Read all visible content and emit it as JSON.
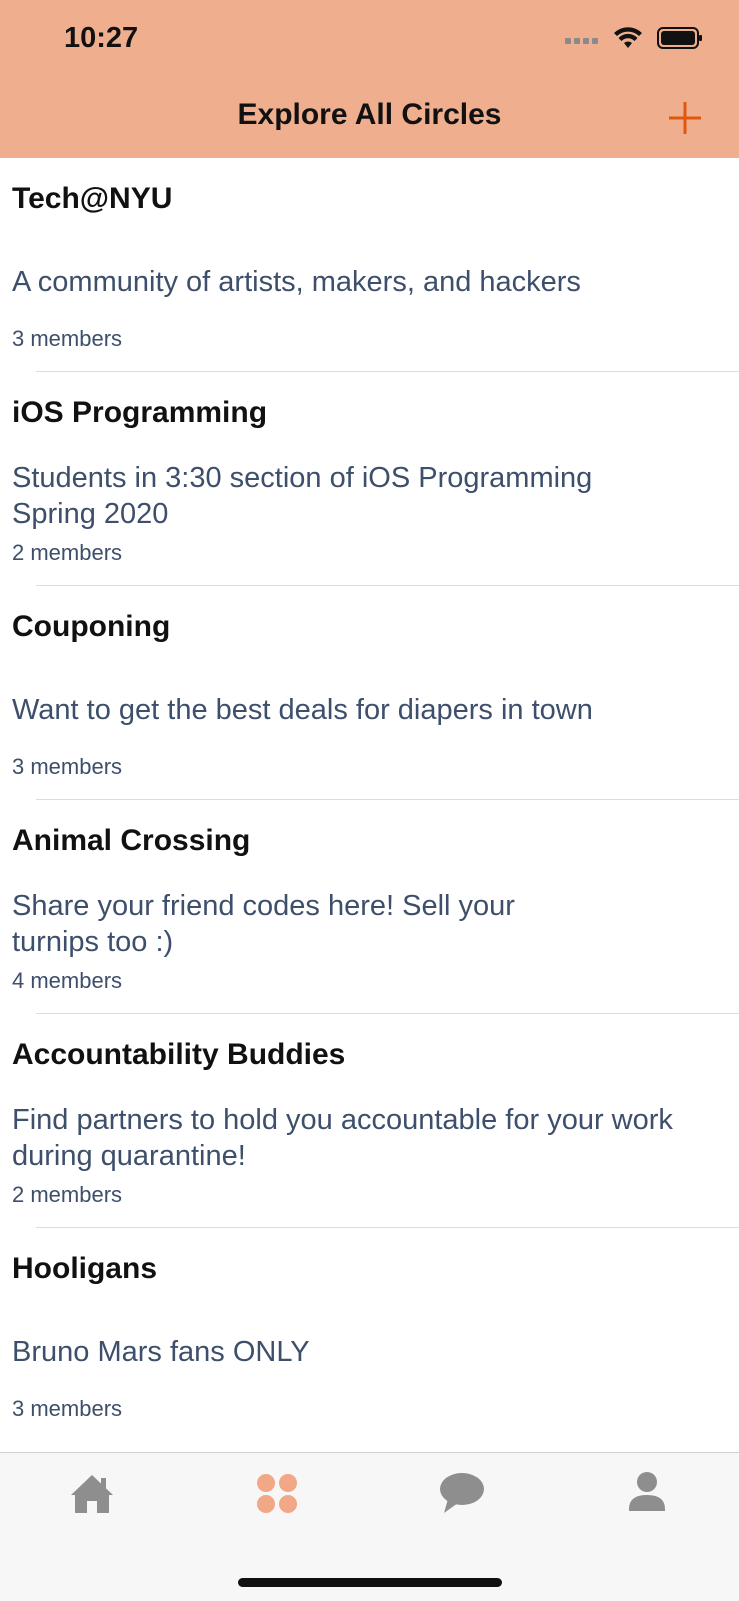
{
  "status": {
    "time": "10:27"
  },
  "nav": {
    "title": "Explore All Circles"
  },
  "circles": [
    {
      "name": "Tech@NYU",
      "description": "A community of artists, makers, and hackers",
      "members": "3 members"
    },
    {
      "name": "iOS Programming",
      "description": "Students in 3:30 section of iOS Programming Spring 2020",
      "members": "2 members"
    },
    {
      "name": "Couponing",
      "description": "Want to get the best deals for diapers in town",
      "members": "3 members"
    },
    {
      "name": "Animal Crossing",
      "description": "Share your friend codes here! Sell your turnips too :)",
      "members": "4 members"
    },
    {
      "name": "Accountability Buddies",
      "description": "Find partners to hold you accountable for your work during quarantine!",
      "members": "2 members"
    },
    {
      "name": "Hooligans",
      "description": "Bruno Mars fans ONLY",
      "members": "3 members"
    }
  ],
  "tabs": [
    {
      "icon": "home-icon",
      "selected": false
    },
    {
      "icon": "circles-icon",
      "selected": true
    },
    {
      "icon": "chat-icon",
      "selected": false
    },
    {
      "icon": "profile-icon",
      "selected": false
    }
  ],
  "colors": {
    "header": "#efaf8e",
    "accent": "#e2570f",
    "tab_selected": "#f2a887",
    "tab_inactive": "#8e8e8e",
    "description_text": "#3d4f6b"
  }
}
